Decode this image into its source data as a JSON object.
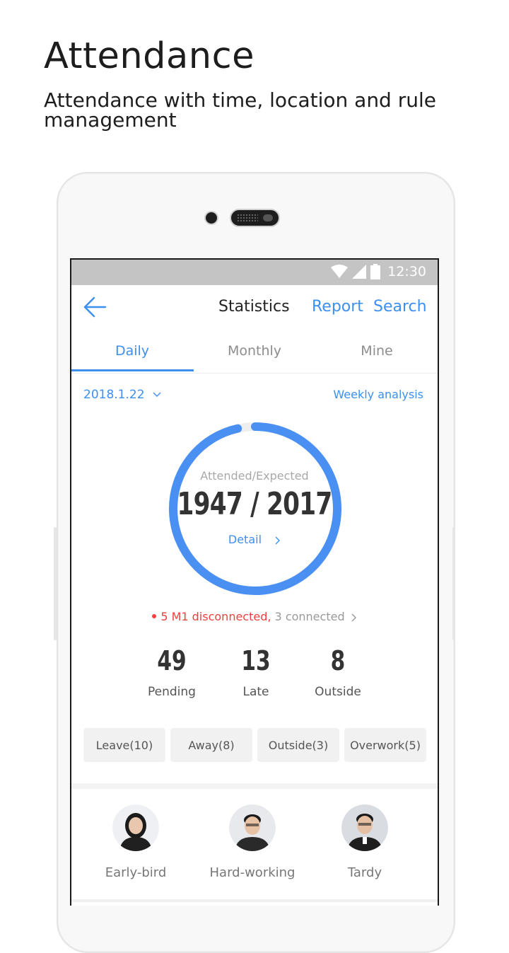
{
  "headline": "Attendance",
  "subline": "Attendance with time, location and rule management",
  "status": {
    "time": "12:30"
  },
  "appbar": {
    "title": "Statistics",
    "report": "Report",
    "search": "Search"
  },
  "tabs": [
    {
      "label": "Daily",
      "active": true
    },
    {
      "label": "Monthly"
    },
    {
      "label": "Mine"
    }
  ],
  "date_selector": {
    "value": "2018.1.22",
    "icon": "chevron-down-icon"
  },
  "weekly_analysis": "Weekly analysis",
  "ring": {
    "label": "Attended/Expected",
    "attended": 1947,
    "expected": 2017,
    "value_text": "1947 / 2017",
    "detail": "Detail",
    "progress_color": "#4a8ff2",
    "track_color": "#eeeeee"
  },
  "devices": {
    "disconnected": "5 M1 disconnected,",
    "connected": "3 connected"
  },
  "stats": [
    {
      "value": "49",
      "label": "Pending"
    },
    {
      "value": "13",
      "label": "Late"
    },
    {
      "value": "8",
      "label": "Outside"
    }
  ],
  "chips": [
    "Leave(10)",
    "Away(8)",
    "Outside(3)",
    "Overwork(5)"
  ],
  "people": [
    {
      "label": "Early-bird"
    },
    {
      "label": "Hard-working"
    },
    {
      "label": "Tardy"
    }
  ],
  "colors": {
    "accent": "#3d8ff0",
    "alert": "#ef3f3f"
  }
}
